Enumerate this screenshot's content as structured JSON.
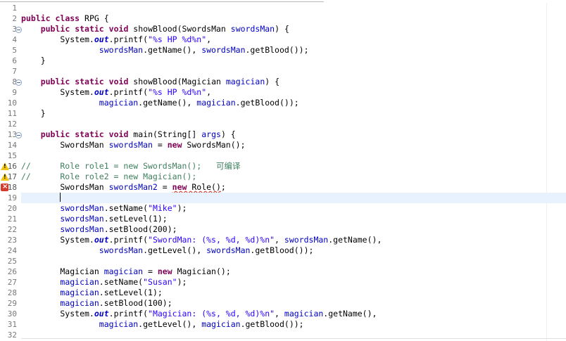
{
  "editor": {
    "lines": [
      {
        "n": "1",
        "segs": []
      },
      {
        "n": "2",
        "segs": [
          [
            "kw",
            "public"
          ],
          [
            "t",
            " "
          ],
          [
            "kw",
            "class"
          ],
          [
            "t",
            " RPG {"
          ]
        ]
      },
      {
        "n": "3",
        "fold": true,
        "segs": [
          [
            "t",
            "    "
          ],
          [
            "kw",
            "public"
          ],
          [
            "t",
            " "
          ],
          [
            "kw",
            "static"
          ],
          [
            "t",
            " "
          ],
          [
            "kw",
            "void"
          ],
          [
            "t",
            " showBlood(SwordsMan "
          ],
          [
            "fld",
            "swordsMan"
          ],
          [
            "t",
            ") {"
          ]
        ]
      },
      {
        "n": "4",
        "segs": [
          [
            "t",
            "        System."
          ],
          [
            "sfld",
            "out"
          ],
          [
            "t",
            ".printf("
          ],
          [
            "str",
            "\"%s HP %d%n\""
          ],
          [
            "t",
            ","
          ]
        ]
      },
      {
        "n": "5",
        "segs": [
          [
            "t",
            "                "
          ],
          [
            "fld",
            "swordsMan"
          ],
          [
            "t",
            ".getName(), "
          ],
          [
            "fld",
            "swordsMan"
          ],
          [
            "t",
            ".getBlood());"
          ]
        ]
      },
      {
        "n": "6",
        "segs": [
          [
            "t",
            "    }"
          ]
        ]
      },
      {
        "n": "7",
        "segs": []
      },
      {
        "n": "8",
        "fold": true,
        "segs": [
          [
            "t",
            "    "
          ],
          [
            "kw",
            "public"
          ],
          [
            "t",
            " "
          ],
          [
            "kw",
            "static"
          ],
          [
            "t",
            " "
          ],
          [
            "kw",
            "void"
          ],
          [
            "t",
            " showBlood(Magician "
          ],
          [
            "fld",
            "magician"
          ],
          [
            "t",
            ") {"
          ]
        ]
      },
      {
        "n": "9",
        "segs": [
          [
            "t",
            "        System."
          ],
          [
            "sfld",
            "out"
          ],
          [
            "t",
            ".printf("
          ],
          [
            "str",
            "\"%s HP %d%n\""
          ],
          [
            "t",
            ","
          ]
        ]
      },
      {
        "n": "10",
        "segs": [
          [
            "t",
            "                "
          ],
          [
            "fld",
            "magician"
          ],
          [
            "t",
            ".getName(), "
          ],
          [
            "fld",
            "magician"
          ],
          [
            "t",
            ".getBlood());"
          ]
        ]
      },
      {
        "n": "11",
        "segs": [
          [
            "t",
            "    }"
          ]
        ]
      },
      {
        "n": "12",
        "segs": []
      },
      {
        "n": "13",
        "fold": true,
        "segs": [
          [
            "t",
            "    "
          ],
          [
            "kw",
            "public"
          ],
          [
            "t",
            " "
          ],
          [
            "kw",
            "static"
          ],
          [
            "t",
            " "
          ],
          [
            "kw",
            "void"
          ],
          [
            "t",
            " main(String[] "
          ],
          [
            "fld",
            "args"
          ],
          [
            "t",
            ") {"
          ]
        ]
      },
      {
        "n": "14",
        "segs": [
          [
            "t",
            "        SwordsMan "
          ],
          [
            "fld",
            "swordsMan"
          ],
          [
            "t",
            " = "
          ],
          [
            "kw",
            "new"
          ],
          [
            "t",
            " SwordsMan();"
          ]
        ]
      },
      {
        "n": "15",
        "segs": []
      },
      {
        "n": "16",
        "marker": "warning",
        "segs": [
          [
            "cmt",
            "//      Role role1 = new SwordsMan();   可编译"
          ]
        ]
      },
      {
        "n": "17",
        "marker": "warning",
        "segs": [
          [
            "cmt",
            "//      Role role2 = new Magician();"
          ]
        ]
      },
      {
        "n": "18",
        "marker": "error",
        "segs": [
          [
            "t",
            "        SwordsMan "
          ],
          [
            "fld",
            "swordsMan2"
          ],
          [
            "t",
            " = "
          ],
          [
            "kwsq",
            "new"
          ],
          [
            "sq",
            " Role()"
          ],
          [
            "t",
            ";"
          ]
        ]
      },
      {
        "n": "19",
        "current": true,
        "segs": [
          [
            "t",
            "        "
          ],
          [
            "caret",
            ""
          ]
        ]
      },
      {
        "n": "20",
        "segs": [
          [
            "t",
            "        "
          ],
          [
            "fld",
            "swordsMan"
          ],
          [
            "t",
            ".setName("
          ],
          [
            "str",
            "\"Mike\""
          ],
          [
            "t",
            ");"
          ]
        ]
      },
      {
        "n": "21",
        "segs": [
          [
            "t",
            "        "
          ],
          [
            "fld",
            "swordsMan"
          ],
          [
            "t",
            ".setLevel(1);"
          ]
        ]
      },
      {
        "n": "22",
        "segs": [
          [
            "t",
            "        "
          ],
          [
            "fld",
            "swordsMan"
          ],
          [
            "t",
            ".setBlood(200);"
          ]
        ]
      },
      {
        "n": "23",
        "segs": [
          [
            "t",
            "        System."
          ],
          [
            "sfld",
            "out"
          ],
          [
            "t",
            ".printf("
          ],
          [
            "str",
            "\"SwordMan: (%s, %d, %d)%n\""
          ],
          [
            "t",
            ", "
          ],
          [
            "fld",
            "swordsMan"
          ],
          [
            "t",
            ".getName(),"
          ]
        ]
      },
      {
        "n": "24",
        "segs": [
          [
            "t",
            "                "
          ],
          [
            "fld",
            "swordsMan"
          ],
          [
            "t",
            ".getLevel(), "
          ],
          [
            "fld",
            "swordsMan"
          ],
          [
            "t",
            ".getBlood());"
          ]
        ]
      },
      {
        "n": "25",
        "segs": []
      },
      {
        "n": "26",
        "segs": [
          [
            "t",
            "        Magician "
          ],
          [
            "fld",
            "magician"
          ],
          [
            "t",
            " = "
          ],
          [
            "kw",
            "new"
          ],
          [
            "t",
            " Magician();"
          ]
        ]
      },
      {
        "n": "27",
        "segs": [
          [
            "t",
            "        "
          ],
          [
            "fld",
            "magician"
          ],
          [
            "t",
            ".setName("
          ],
          [
            "str",
            "\"Susan\""
          ],
          [
            "t",
            ");"
          ]
        ]
      },
      {
        "n": "28",
        "segs": [
          [
            "t",
            "        "
          ],
          [
            "fld",
            "magician"
          ],
          [
            "t",
            ".setLevel(1);"
          ]
        ]
      },
      {
        "n": "29",
        "segs": [
          [
            "t",
            "        "
          ],
          [
            "fld",
            "magician"
          ],
          [
            "t",
            ".setBlood(100);"
          ]
        ]
      },
      {
        "n": "30",
        "segs": [
          [
            "t",
            "        System."
          ],
          [
            "sfld",
            "out"
          ],
          [
            "t",
            ".printf("
          ],
          [
            "str",
            "\"Magician: (%s, %d, %d)%n\""
          ],
          [
            "t",
            ", "
          ],
          [
            "fld",
            "magician"
          ],
          [
            "t",
            ".getName(),"
          ]
        ]
      },
      {
        "n": "31",
        "segs": [
          [
            "t",
            "                "
          ],
          [
            "fld",
            "magician"
          ],
          [
            "t",
            ".getLevel(), "
          ],
          [
            "fld",
            "magician"
          ],
          [
            "t",
            ".getBlood());"
          ]
        ]
      },
      {
        "n": "32",
        "segs": []
      }
    ]
  },
  "colors": {
    "keyword": "#7f0055",
    "string": "#2a00ff",
    "field": "#0000c0",
    "comment": "#3f7f5f",
    "current_line": "#e8f2fe",
    "error": "#d23b2e",
    "warning": "#f1c40f"
  },
  "icons": {
    "fold": "collapse-minus-icon",
    "warning": "warning-triangle-icon",
    "error": "error-marker-icon"
  }
}
